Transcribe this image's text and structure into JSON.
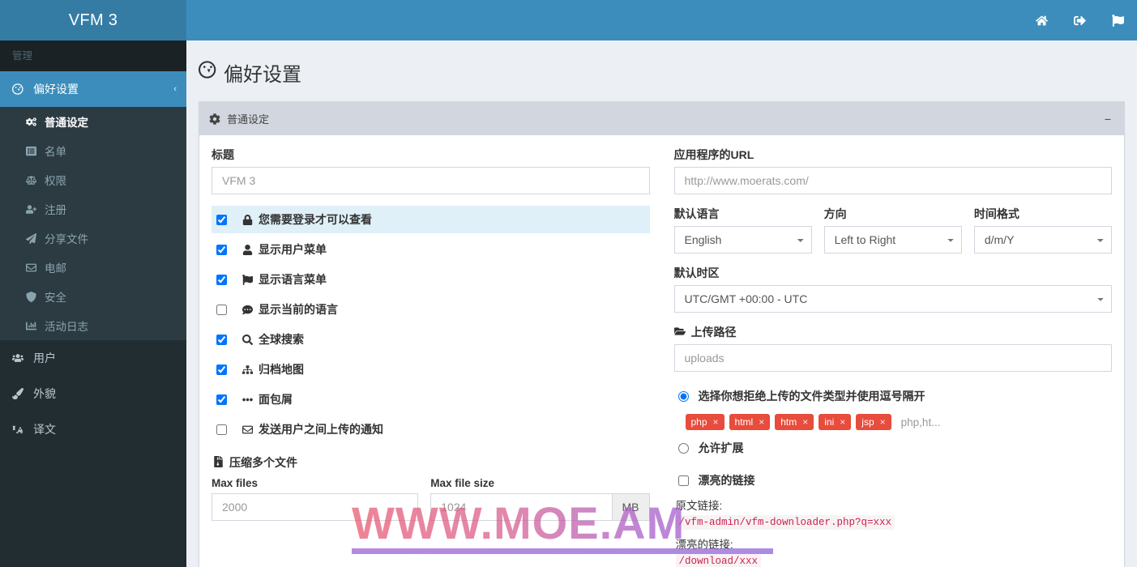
{
  "navbar": {
    "brand": "VFM 3",
    "icons": [
      {
        "name": "home-icon",
        "label": "Home"
      },
      {
        "name": "sign-out-icon",
        "label": "Sign out"
      },
      {
        "name": "flag-icon",
        "label": "Language"
      }
    ]
  },
  "sidebar": {
    "header": "管理",
    "active_item": {
      "label": "偏好设置",
      "icon": "dashboard-icon",
      "caret": "‹"
    },
    "submenu": [
      {
        "label": "普通设定",
        "icon": "gears-icon",
        "current": true
      },
      {
        "label": "名单",
        "icon": "list-alt-icon",
        "current": false
      },
      {
        "label": "权限",
        "icon": "balance-scale-icon",
        "current": false
      },
      {
        "label": "注册",
        "icon": "user-plus-icon",
        "current": false
      },
      {
        "label": "分享文件",
        "icon": "paper-plane-icon",
        "current": false
      },
      {
        "label": "电邮",
        "icon": "envelope-icon",
        "current": false
      },
      {
        "label": "安全",
        "icon": "shield-icon",
        "current": false
      },
      {
        "label": "活动日志",
        "icon": "bar-chart-icon",
        "current": false
      }
    ],
    "items": [
      {
        "label": "用户",
        "icon": "users-icon"
      },
      {
        "label": "外貌",
        "icon": "paint-brush-icon"
      },
      {
        "label": "译文",
        "icon": "language-icon"
      }
    ]
  },
  "page": {
    "title": "偏好设置",
    "title_icon": "dashboard-icon"
  },
  "box": {
    "header_title": "普通设定",
    "header_icon": "gear-icon",
    "collapse_label": "−"
  },
  "left_column": {
    "title_label": "标题",
    "title_value": "VFM 3",
    "checkboxes": [
      {
        "label": "您需要登录才可以查看",
        "icon": "lock-icon",
        "checked": true,
        "highlight": true
      },
      {
        "label": "显示用户菜单",
        "icon": "user-icon",
        "checked": true,
        "highlight": false
      },
      {
        "label": "显示语言菜单",
        "icon": "flag-icon",
        "checked": true,
        "highlight": false
      },
      {
        "label": "显示当前的语言",
        "icon": "comment-icon",
        "checked": false,
        "highlight": false
      },
      {
        "label": "全球搜索",
        "icon": "search-icon",
        "checked": true,
        "highlight": false
      },
      {
        "label": "归档地图",
        "icon": "sitemap-icon",
        "checked": true,
        "highlight": false
      },
      {
        "label": "面包屑",
        "icon": "ellipsis-icon",
        "checked": true,
        "highlight": false
      },
      {
        "label": "发送用户之间上传的通知",
        "icon": "envelope-icon",
        "checked": false,
        "highlight": false
      }
    ],
    "zip_section": {
      "heading": "压缩多个文件",
      "heading_icon": "file-archive-icon",
      "max_files_label": "Max files",
      "max_files_value": "2000",
      "max_file_size_label": "Max file size",
      "max_file_size_value": "1024",
      "max_file_size_unit": "MB"
    }
  },
  "right_column": {
    "app_url_label": "应用程序的URL",
    "app_url_value": "http://www.moerats.com/",
    "default_language_label": "默认语言",
    "default_language_value": "English",
    "direction_label": "方向",
    "direction_value": "Left to Right",
    "time_format_label": "时间格式",
    "time_format_value": "d/m/Y",
    "default_timezone_label": "默认时区",
    "default_timezone_value": "UTC/GMT +00:00 - UTC",
    "upload_path_label": "上传路径",
    "upload_path_icon": "folder-open-icon",
    "upload_path_value": "uploads",
    "deny_radio_label": "选择你想拒绝上传的文件类型并使用逗号隔开",
    "deny_radio_selected": true,
    "tags": [
      "php",
      "html",
      "htm",
      "ini",
      "jsp"
    ],
    "tags_rest": "php,ht...",
    "allow_radio_label": "允许扩展",
    "allow_radio_selected": false,
    "pretty_link_label": "漂亮的链接",
    "pretty_link_checked": false,
    "original_link_label": "原文链接:",
    "original_link_value": "/vfm-admin/vfm-downloader.php?q=xxx",
    "pretty_link_hint_label": "漂亮的链接:",
    "pretty_link_value": "/download/xxx"
  },
  "watermark": {
    "text": "WWW.MOE.AM"
  },
  "colors": {
    "navbar": "#3c8dbc",
    "logo": "#357ca5",
    "sidebar": "#222d32",
    "submenu": "#2c3b41",
    "content_bg": "#ecf0f5",
    "box_header": "#d2d6de",
    "tag_red": "#e74c3c",
    "highlight_blue": "#dff0f8",
    "code_pink": "#c7254e"
  }
}
